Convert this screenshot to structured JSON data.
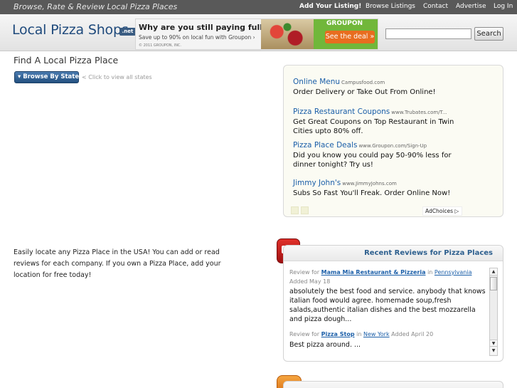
{
  "topbar": {
    "tagline": "Browse, Rate & Review Local Pizza Places",
    "nav": [
      "Add Your Listing!",
      "Browse Listings",
      "Contact",
      "Advertise",
      "Log In"
    ]
  },
  "header": {
    "logo_text": "Local Pizza Shops",
    "logo_suffix": ".net",
    "search_button": "Search"
  },
  "banner_ad": {
    "headline": "Why are you still paying full price?",
    "subline": "Save up to 90% on local fun with Groupon ›",
    "copyright": "© 2011 GROUPON, INC.",
    "brand": "GROUPON",
    "cta": "See the deal »"
  },
  "main": {
    "page_title": "Find A Local Pizza Place",
    "browse_button": "▾ Browse By State",
    "browse_hint": "< Click to view all states",
    "intro_text": "Easily locate any Pizza Place in the USA! You can add or read reviews for each company. If you own a Pizza Place, add your location for free today!"
  },
  "sponsored": {
    "items": [
      {
        "title": "Online Menu",
        "url": "Campusfood.com",
        "desc": "Order Delivery or Take Out From Online!"
      },
      {
        "title": "Pizza Restaurant Coupons",
        "url": "www.Trubates.com/T...",
        "desc": "Get Great Coupons on Top Restaurant in Twin Cities upto 80% off."
      },
      {
        "title": "Pizza Place Deals",
        "url": "www.Groupon.com/Sign-Up",
        "desc": "Did you know you could pay 50-90% less for dinner tonight? Try us!"
      },
      {
        "title": "Jimmy John's",
        "url": "www.JimmyJohns.com",
        "desc": "Subs So Fast You'll Freak. Order Online Now!"
      }
    ],
    "adchoices": "AdChoices ▷"
  },
  "reviews": {
    "title": "Recent Reviews for Pizza Places",
    "review_for_label": "Review for",
    "in_label": "in",
    "items": [
      {
        "restaurant": "Mama Mia Restaurant & Pizzeria",
        "state": "Pennsylvania",
        "added": "Added May 18",
        "text": "absolutely the best food and service. anybody that knows italian food would agree. homemade soup,fresh salads,authentic italian dishes and the best mozzarella and pizza dough..."
      },
      {
        "restaurant": "Pizza Stop",
        "state": "New York",
        "added": "Added April 20",
        "text": "Best pizza around. ..."
      }
    ]
  },
  "colors": {
    "topbar": "#595959",
    "logo": "#1f4a7c",
    "link": "#1a5ea8",
    "reviews_title": "#2d5f8e",
    "badge_red": "#d22a24",
    "badge_orange": "#ee8a2a"
  }
}
